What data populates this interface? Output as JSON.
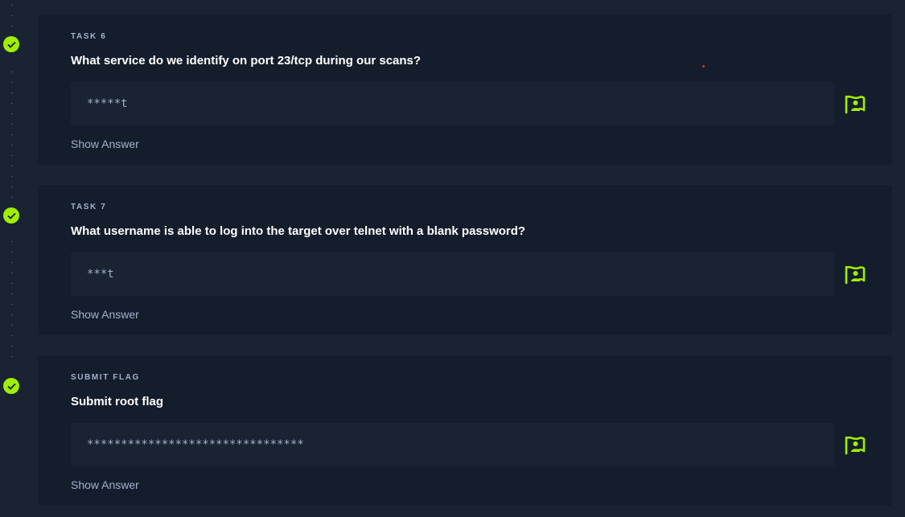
{
  "colors": {
    "background": "#1a2332",
    "card": "#141d2b",
    "accent": "#9fef00",
    "label": "#a4b1cd",
    "question": "#ffffff"
  },
  "tasks": [
    {
      "label": "TASK 6",
      "question": "What service do we identify on port 23/tcp during our scans?",
      "answer_masked": "*****t",
      "show_answer": "Show Answer",
      "completed": true,
      "check_icon": "check-icon",
      "flag_icon": "flag-user-icon"
    },
    {
      "label": "TASK 7",
      "question": "What username is able to log into the target over telnet with a blank password?",
      "answer_masked": "***t",
      "show_answer": "Show Answer",
      "completed": true,
      "check_icon": "check-icon",
      "flag_icon": "flag-user-icon"
    },
    {
      "label": "SUBMIT FLAG",
      "question": "Submit root flag",
      "answer_masked": "********************************",
      "show_answer": "Show Answer",
      "completed": true,
      "check_icon": "check-icon",
      "flag_icon": "flag-user-icon"
    }
  ]
}
